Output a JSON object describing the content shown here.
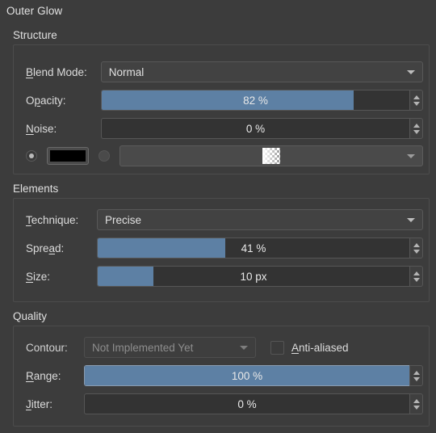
{
  "panel": {
    "title": "Outer Glow"
  },
  "groups": {
    "structure": {
      "title": "Structure",
      "blend_mode": {
        "label_pre": "B",
        "label_post": "lend Mode:",
        "value": "Normal"
      },
      "opacity": {
        "label_pre": "O",
        "label_mn": "p",
        "label_post": "acity:",
        "value": "82 %",
        "fill_percent": 82
      },
      "noise": {
        "label_pre": "N",
        "label_post": "oise:",
        "value": "0 %",
        "fill_percent": 0
      },
      "color_mode": {
        "solid_selected": true,
        "gradient_selected": false,
        "color": "#000000",
        "gradient_name": "white-to-transparent"
      }
    },
    "elements": {
      "title": "Elements",
      "technique": {
        "label_pre": "T",
        "label_post": "echnique:",
        "value": "Precise"
      },
      "spread": {
        "label_pre": "Spre",
        "label_mn": "a",
        "label_post": "d:",
        "value": "41 %",
        "fill_percent": 41
      },
      "size": {
        "label_pre": "S",
        "label_post": "ize:",
        "value": "10 px",
        "fill_percent": 18
      }
    },
    "quality": {
      "title": "Quality",
      "contour": {
        "label": "Contour:",
        "value": "Not Implemented Yet",
        "disabled": true
      },
      "anti_aliased": {
        "label_pre": "A",
        "label_post": "nti-aliased",
        "checked": false
      },
      "range": {
        "label_pre": "R",
        "label_post": "ange:",
        "value": "100 %",
        "fill_percent": 100
      },
      "jitter": {
        "label_pre": "J",
        "label_post": "itter:",
        "value": "0 %",
        "fill_percent": 0
      }
    }
  },
  "colors": {
    "background": "#3c3c3c",
    "slider_fill": "#5d80a4",
    "field_bg": "#333333",
    "text": "#dcdcdc"
  }
}
